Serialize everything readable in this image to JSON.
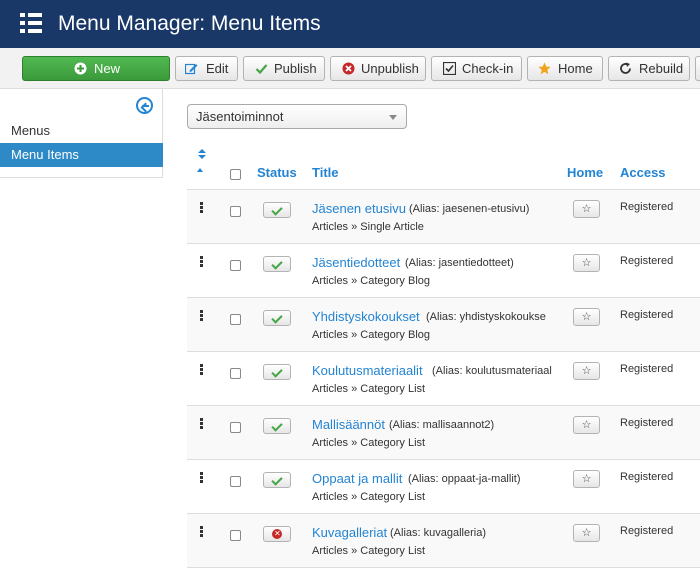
{
  "header": {
    "title": "Menu Manager: Menu Items",
    "icon": "list-menu-icon"
  },
  "toolbar": {
    "new": "New",
    "edit": "Edit",
    "publish": "Publish",
    "unpublish": "Unpublish",
    "checkin": "Check-in",
    "home": "Home",
    "rebuild": "Rebuild"
  },
  "sidebar": {
    "items": [
      {
        "label": "Menus",
        "active": false
      },
      {
        "label": "Menu Items",
        "active": true
      }
    ]
  },
  "filter": {
    "selected": "Jäsentoiminnot"
  },
  "table": {
    "headers": {
      "status": "Status",
      "title": "Title",
      "home": "Home",
      "access": "Access"
    },
    "rows": [
      {
        "title": "Jäsenen etusivu",
        "alias": "(Alias: jaesenen-etusivu)",
        "type": "Articles » Single Article",
        "published": true,
        "access": "Registered"
      },
      {
        "title": "Jäsentiedotteet",
        "alias": "(Alias: jasentiedotteet)",
        "type": "Articles » Category Blog",
        "published": true,
        "access": "Registered"
      },
      {
        "title": "Yhdistyskokoukset",
        "alias": "(Alias: yhdistyskokoukse",
        "type": "Articles » Category Blog",
        "published": true,
        "access": "Registered"
      },
      {
        "title": "Koulutusmateriaalit",
        "alias": "(Alias: koulutusmateriaal",
        "type": "Articles » Category List",
        "published": true,
        "access": "Registered"
      },
      {
        "title": "Mallisäännöt",
        "alias": "(Alias: mallisaannot2)",
        "type": "Articles » Category List",
        "published": true,
        "access": "Registered"
      },
      {
        "title": "Oppaat ja mallit",
        "alias": "(Alias: oppaat-ja-mallit)",
        "type": "Articles » Category List",
        "published": true,
        "access": "Registered"
      },
      {
        "title": "Kuvagalleriat",
        "alias": "(Alias: kuvagalleria)",
        "type": "Articles » Category List",
        "published": false,
        "access": "Registered"
      }
    ]
  },
  "colors": {
    "header_bg": "#1a3867",
    "link": "#2384d3",
    "success": "#46a546",
    "danger": "#c52828",
    "active_side": "#2d8ac7"
  }
}
